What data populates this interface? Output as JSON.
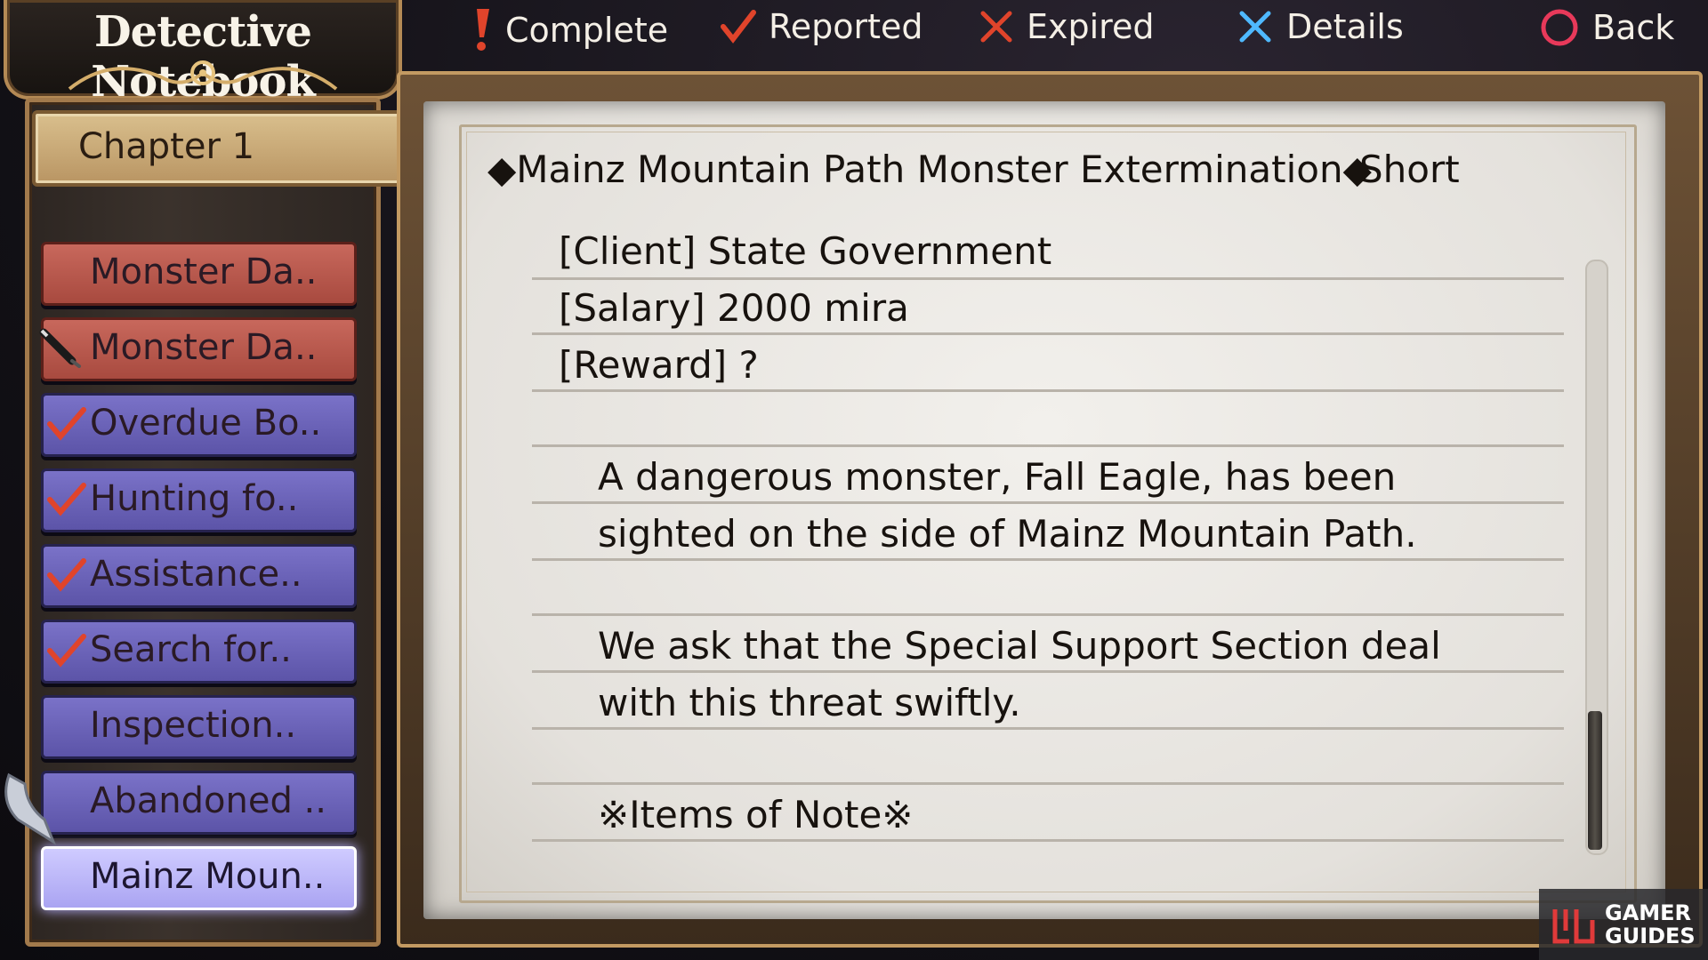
{
  "legend": {
    "complete": "Complete",
    "reported": "Reported",
    "expired": "Expired",
    "details": "Details",
    "back": "Back"
  },
  "title": "Detective Notebook",
  "chapter": "Chapter 1",
  "quests": [
    {
      "label": "Monster Da..",
      "status": "new"
    },
    {
      "label": "Monster Da..",
      "status": "in-progress"
    },
    {
      "label": "Overdue Bo..",
      "status": "reported"
    },
    {
      "label": "Hunting fo..",
      "status": "reported"
    },
    {
      "label": "Assistance..",
      "status": "reported"
    },
    {
      "label": "Search for..",
      "status": "reported"
    },
    {
      "label": "Inspection..",
      "status": "none"
    },
    {
      "label": "Abandoned ..",
      "status": "none"
    },
    {
      "label": "Mainz Moun..",
      "status": "selected"
    }
  ],
  "detail": {
    "title": "◆Mainz Mountain Path Monster Extermination◆",
    "length": "Short",
    "client": "[Client]  State Government",
    "salary": "[Salary] 2000 mira",
    "reward": "[Reward] ?",
    "description_1": "A dangerous monster, Fall Eagle, has been",
    "description_2": "sighted on the side of Mainz Mountain Path.",
    "description_3": "We ask that the Special Support Section deal",
    "description_4": "with this threat swiftly.",
    "items_heading": "※Items of Note※"
  },
  "scroll": {
    "position": 0.78
  },
  "watermark": {
    "line1": "GAMER",
    "line2": "GUIDES"
  },
  "colors": {
    "complete": "#e0442b",
    "reported": "#e0442b",
    "expired": "#e0442b",
    "details": "#4fb9ff",
    "back": "#e8395a",
    "quest_red": "#b85448",
    "quest_blue": "#6860b8",
    "quest_selected": "#bfb9fb"
  }
}
